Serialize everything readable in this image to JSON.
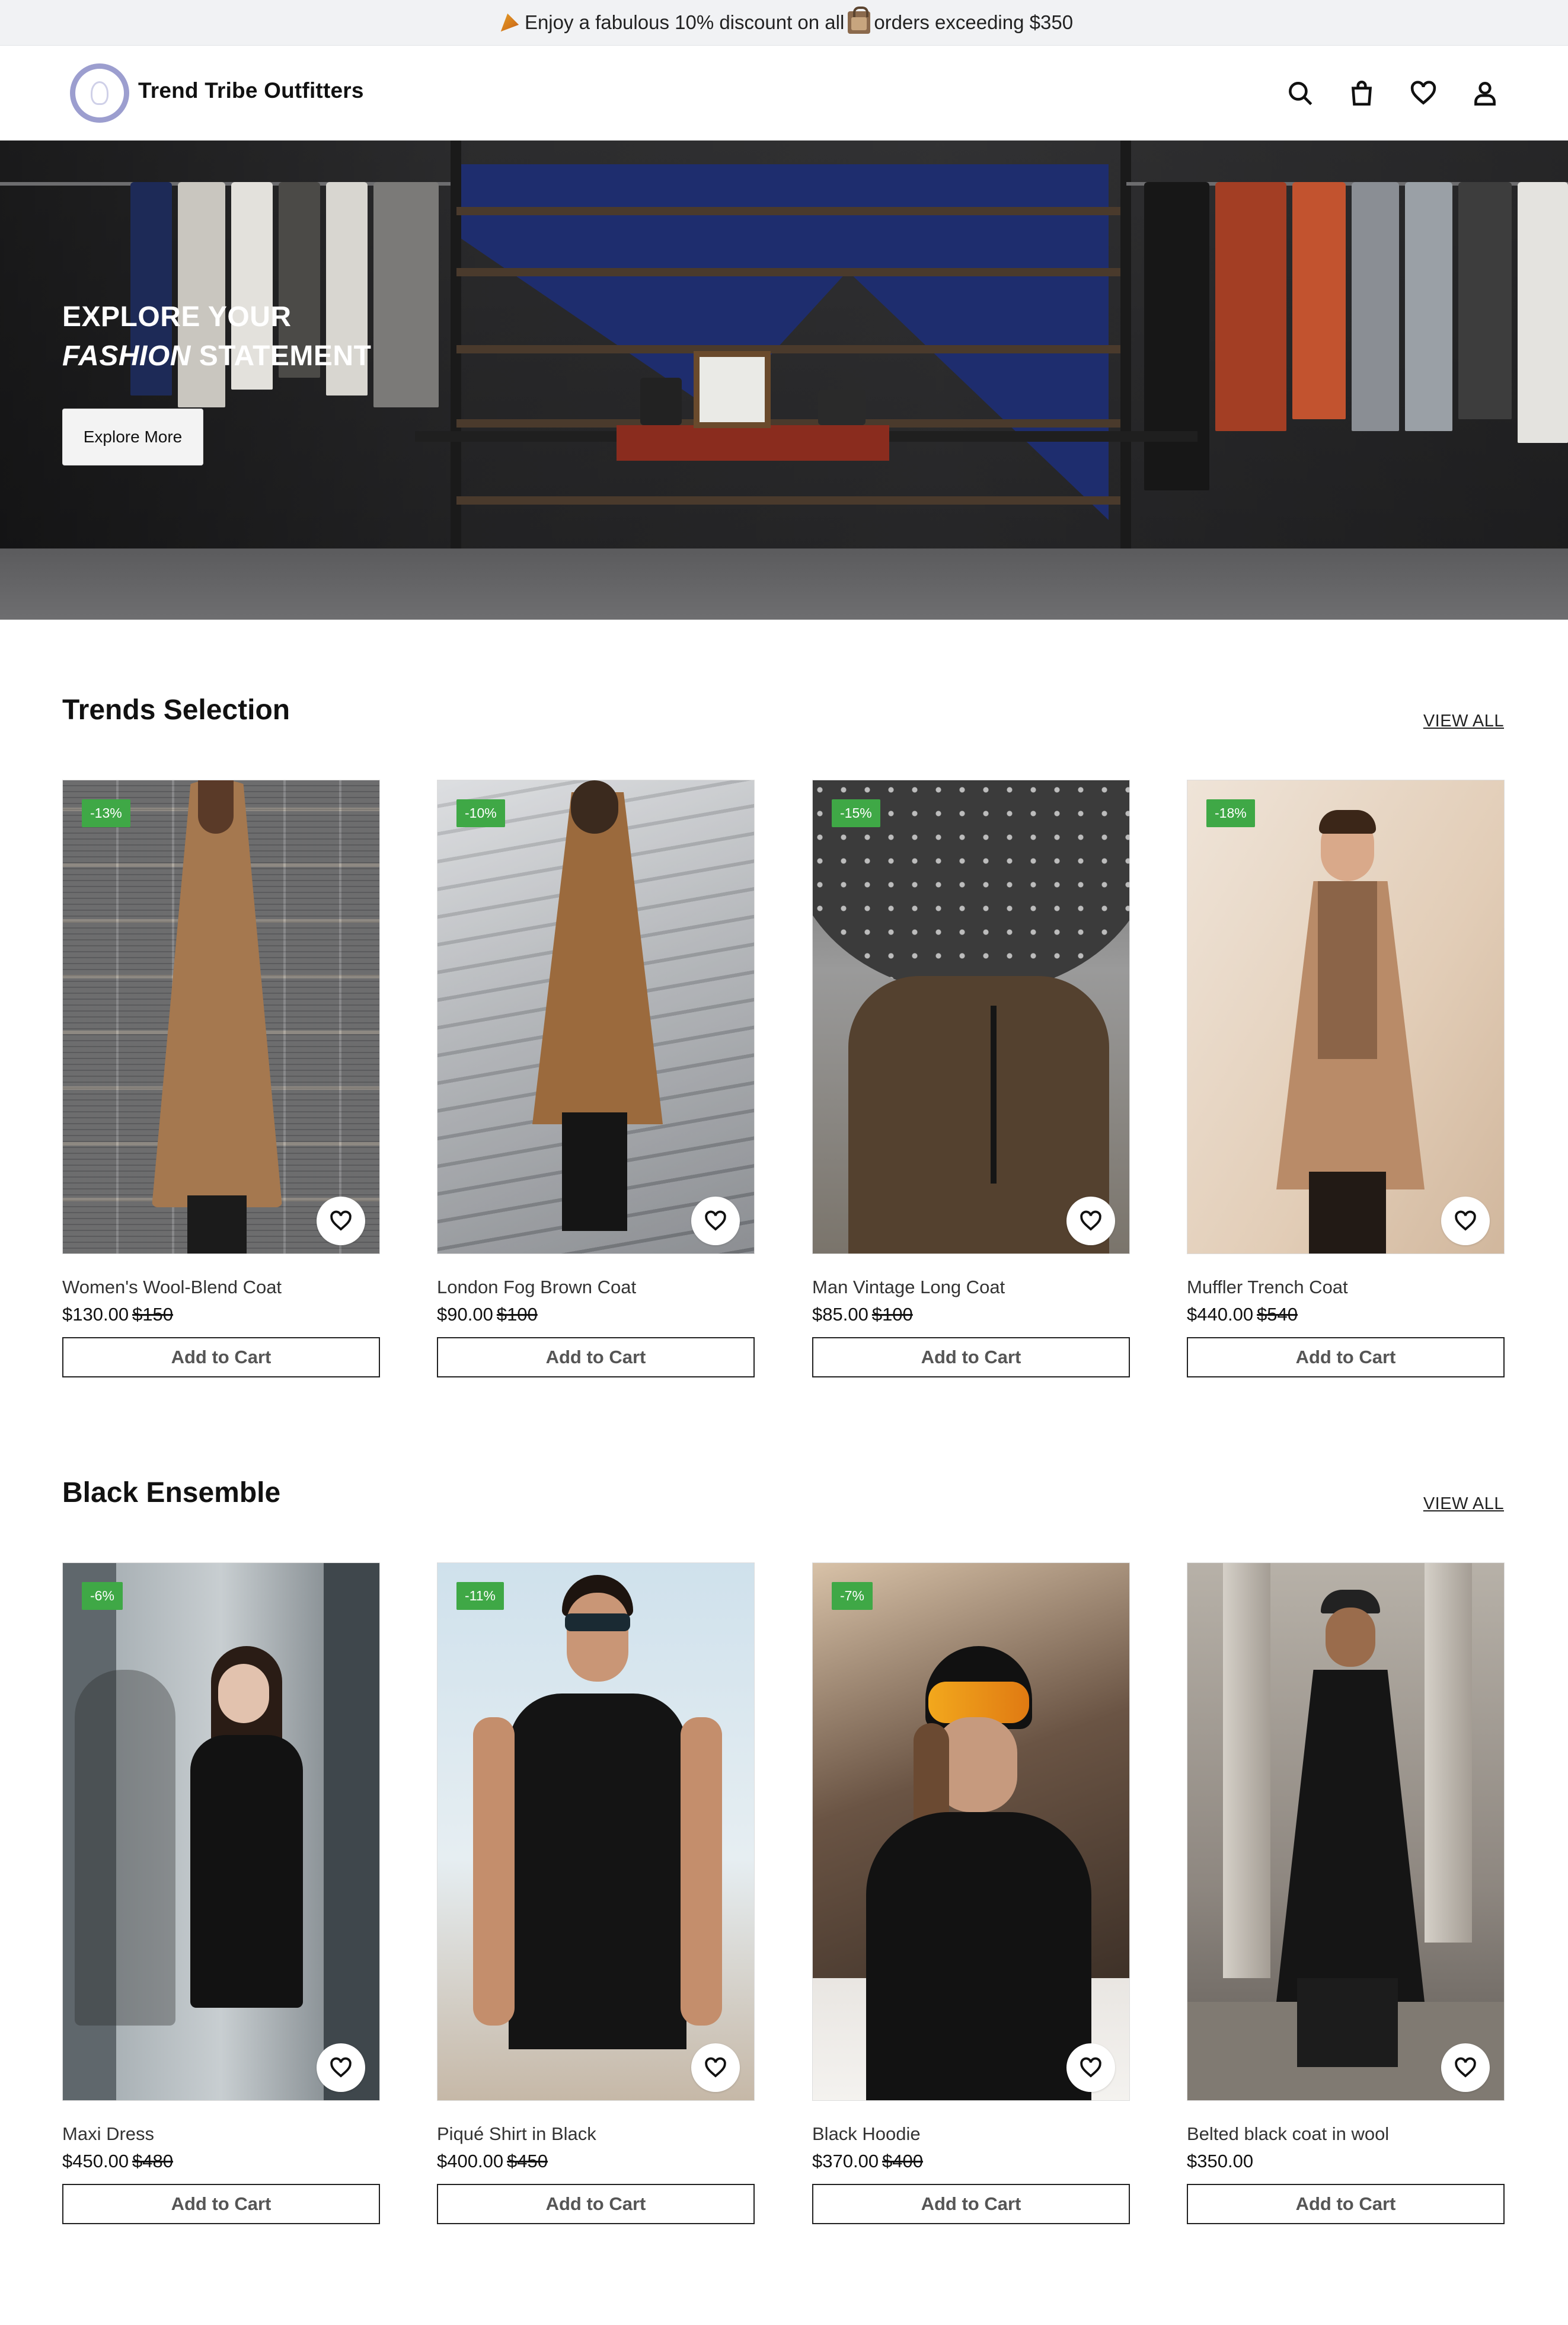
{
  "announcement": {
    "text_before": "Enjoy a fabulous 10% discount on all",
    "text_after": "orders exceeding $350",
    "icon_left": "party-popper-icon",
    "icon_mid": "shopping-bags-icon"
  },
  "header": {
    "brand": "Trend Tribe Outfitters",
    "icons": [
      "search-icon",
      "shopping-bag-icon",
      "heart-icon",
      "user-icon"
    ]
  },
  "hero": {
    "title_line1": "EXPLORE YOUR",
    "title_emphasis": "FASHION",
    "title_rest": "STATEMENT",
    "button_label": "Explore More"
  },
  "sections": [
    {
      "title": "Trends Selection",
      "view_all": "VIEW ALL",
      "products": [
        {
          "name": "Women's Wool-Blend Coat",
          "price": "$130.00",
          "old_price": "$150",
          "badge": "-13%",
          "cart": "Add to Cart"
        },
        {
          "name": "London Fog Brown Coat",
          "price": "$90.00",
          "old_price": "$100",
          "badge": "-10%",
          "cart": "Add to Cart"
        },
        {
          "name": "Man Vintage Long Coat",
          "price": "$85.00",
          "old_price": "$100",
          "badge": "-15%",
          "cart": "Add to Cart"
        },
        {
          "name": "Muffler Trench Coat",
          "price": "$440.00",
          "old_price": "$540",
          "badge": "-18%",
          "cart": "Add to Cart"
        }
      ]
    },
    {
      "title": "Black Ensemble",
      "view_all": "VIEW ALL",
      "products": [
        {
          "name": "Maxi Dress",
          "price": "$450.00",
          "old_price": "$480",
          "badge": "-6%",
          "cart": "Add to Cart"
        },
        {
          "name": "Piqué Shirt in Black",
          "price": "$400.00",
          "old_price": "$450",
          "badge": "-11%",
          "cart": "Add to Cart"
        },
        {
          "name": "Black Hoodie",
          "price": "$370.00",
          "old_price": "$400",
          "badge": "-7%",
          "cart": "Add to Cart"
        },
        {
          "name": "Belted black coat in wool",
          "price": "$350.00",
          "old_price": "",
          "badge": "",
          "cart": "Add to Cart"
        }
      ]
    }
  ],
  "colors": {
    "badge": "#3fa846",
    "topbar_bg": "#f1f2f4",
    "logo_ring": "#9c9ecf"
  }
}
